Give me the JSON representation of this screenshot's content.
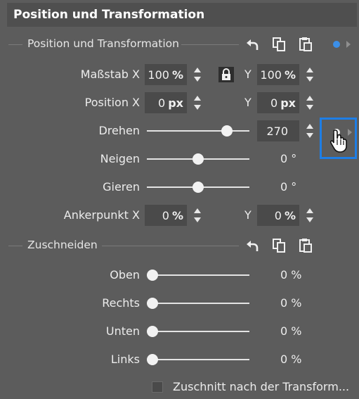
{
  "panel": {
    "title": "Position und Transformation"
  },
  "section_position": {
    "title": "Position und Transformation",
    "icons": [
      "undo-icon",
      "copy-icon",
      "paste-icon"
    ],
    "keyframe_color": "#3b8fe8"
  },
  "rows": {
    "scale": {
      "label": "Maßstab X",
      "x_value": "100",
      "x_unit": "%",
      "y_label": "Y",
      "y_value": "100",
      "y_unit": "%",
      "lock": "lock-icon"
    },
    "position": {
      "label": "Position X",
      "x_value": "0",
      "x_unit": "px",
      "y_label": "Y",
      "y_value": "0",
      "y_unit": "px"
    },
    "rotate": {
      "label": "Drehen",
      "value": "270",
      "slider_fraction": 0.78
    },
    "tilt": {
      "label": "Neigen",
      "value": "0 °",
      "slider_fraction": 0.5
    },
    "yaw": {
      "label": "Gieren",
      "value": "0 °",
      "slider_fraction": 0.5
    },
    "anchor": {
      "label": "Ankerpunkt X",
      "x_value": "0",
      "x_unit": "%",
      "y_label": "Y",
      "y_value": "0",
      "y_unit": "%"
    }
  },
  "section_crop": {
    "title": "Zuschneiden",
    "icons": [
      "undo-icon",
      "copy-icon",
      "paste-icon"
    ],
    "rows": [
      {
        "label": "Oben",
        "value": "0 %",
        "slider_fraction": 0
      },
      {
        "label": "Rechts",
        "value": "0 %",
        "slider_fraction": 0
      },
      {
        "label": "Unten",
        "value": "0 %",
        "slider_fraction": 0
      },
      {
        "label": "Links",
        "value": "0 %",
        "slider_fraction": 0
      }
    ]
  },
  "checkbox": {
    "label": "Zuschnitt nach der Transform...",
    "checked": false
  },
  "colors": {
    "highlight": "#1e7ee6",
    "background": "#5c5c5c",
    "field": "#4a4a4a"
  }
}
